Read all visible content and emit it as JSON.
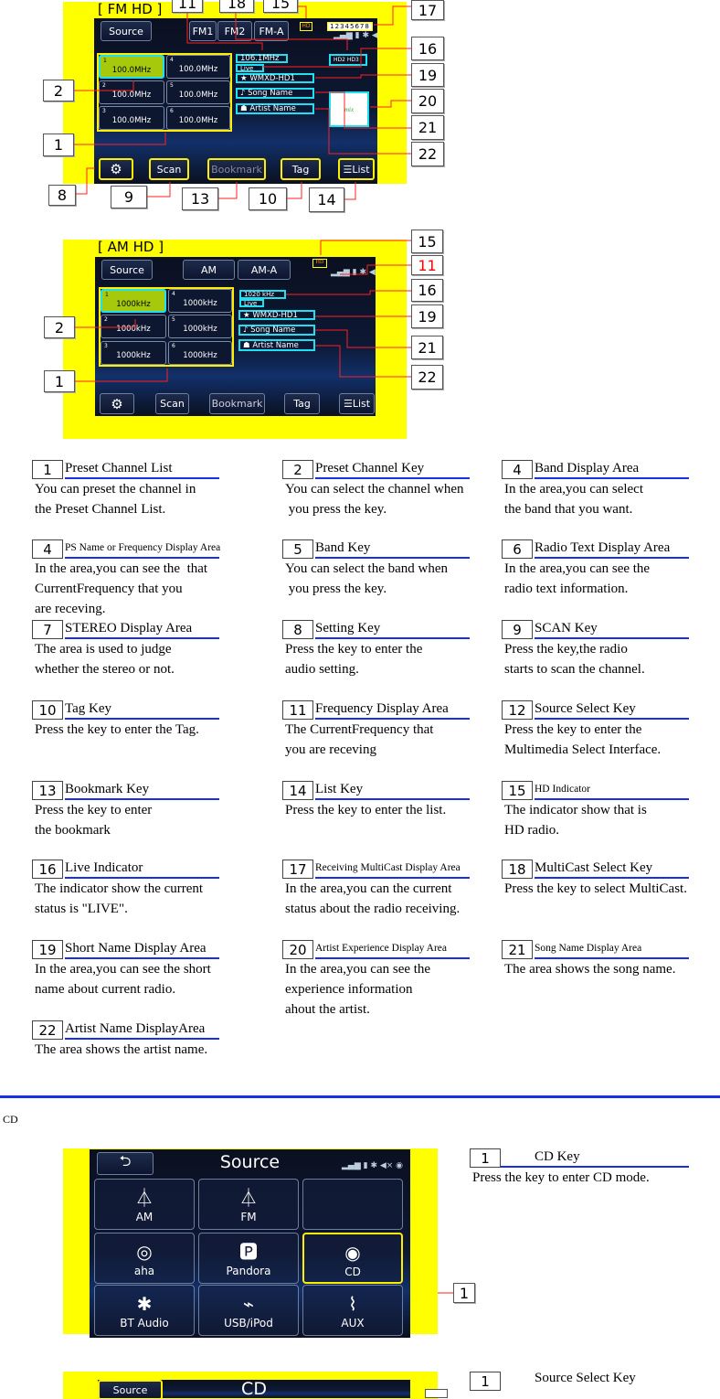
{
  "fm_screen": {
    "heading": "[ FM HD ]",
    "source": "Source",
    "bands": [
      "FM1",
      "FM2",
      "FM-A"
    ],
    "hd_icon": "HD",
    "multicast": "12345678",
    "status_icons": "signal battery bluetooth mute settings",
    "presets": [
      {
        "num": "1",
        "freq": "100.0MHz"
      },
      {
        "num": "2",
        "freq": "100.0MHz"
      },
      {
        "num": "3",
        "freq": "100.0MHz"
      },
      {
        "num": "4",
        "freq": "100.0MHz"
      },
      {
        "num": "5",
        "freq": "100.0MHz"
      },
      {
        "num": "6",
        "freq": "100.0MHz"
      }
    ],
    "frequency": "106.1MHz",
    "live": "Live",
    "multicast_select": "HD2 HD3",
    "short_name": "WMXD-HD1",
    "song_name": "Song Name",
    "artist_name": "Artist Name",
    "bottom": {
      "scan": "Scan",
      "bookmark": "Bookmark",
      "tag": "Tag",
      "list": "List"
    },
    "callouts": {
      "c11": "11",
      "c18": "18",
      "c15": "15",
      "c17": "17",
      "c16": "16",
      "c19": "19",
      "c20": "20",
      "c21": "21",
      "c22": "22",
      "c2": "2",
      "c1": "1",
      "c8": "8",
      "c9": "9",
      "c13": "13",
      "c10": "10",
      "c14": "14"
    }
  },
  "am_screen": {
    "heading": "[ AM HD ]",
    "source": "Source",
    "bands": [
      "AM",
      "AM-A"
    ],
    "presets": [
      {
        "num": "1",
        "freq": "1000kHz"
      },
      {
        "num": "2",
        "freq": "1000kHz"
      },
      {
        "num": "3",
        "freq": "1000kHz"
      },
      {
        "num": "4",
        "freq": "1000kHz"
      },
      {
        "num": "5",
        "freq": "1000kHz"
      },
      {
        "num": "6",
        "freq": "1000kHz"
      }
    ],
    "frequency": "1020 kHz",
    "live": "Live",
    "short_name": "WMXD-HD1",
    "song_name": "Song Name",
    "artist_name": "Artist Name",
    "bottom": {
      "scan": "Scan",
      "bookmark": "Bookmark",
      "tag": "Tag",
      "list": "List"
    },
    "callouts": {
      "c15": "15",
      "c11": "11",
      "c16": "16",
      "c19": "19",
      "c21": "21",
      "c22": "22",
      "c2": "2",
      "c1": "1"
    }
  },
  "descriptions": [
    {
      "num": "1",
      "title": "Preset Channel List",
      "body": "You can preset the channel in\nthe Preset Channel List."
    },
    {
      "num": "2",
      "title": "Preset Channel Key",
      "body": "You can select the channel when\n you press the key."
    },
    {
      "num": "4",
      "title": "Band Display Area",
      "body": "In the area,you can select\nthe band that you want."
    },
    {
      "num": "4",
      "title": "PS Name or Frequency Display Area",
      "small": true,
      "body": "In the area,you can see the  that\nCurrentFrequency that you\nare receving."
    },
    {
      "num": "5",
      "title": "Band Key",
      "body": "You can select the band when\n you press the key."
    },
    {
      "num": "6",
      "title": "Radio Text Display Area",
      "body": "In the area,you can see the\nradio text information."
    },
    {
      "num": "7",
      "title": "STEREO Display Area",
      "body": "The area is used to judge\nwhether the stereo or not."
    },
    {
      "num": "8",
      "title": "Setting Key",
      "body": "Press the key to enter the\naudio setting."
    },
    {
      "num": "9",
      "title": "SCAN Key",
      "body": "Press the key,the radio\nstarts to scan the channel."
    },
    {
      "num": "10",
      "title": "Tag Key",
      "body": "Press the key to enter the Tag."
    },
    {
      "num": "11",
      "title": "Frequency Display Area",
      "body": "The CurrentFrequency that\nyou are receving"
    },
    {
      "num": "12",
      "title": "Source Select Key",
      "body": "Press the key to enter the\nMultimedia Select Interface."
    },
    {
      "num": "13",
      "title": "Bookmark Key",
      "body": "Press the key to enter\nthe bookmark"
    },
    {
      "num": "14",
      "title": "List Key",
      "body": "Press the key to enter the list."
    },
    {
      "num": "15",
      "title": "HD Indicator",
      "small": true,
      "body": "The indicator show that is\nHD radio."
    },
    {
      "num": "16",
      "title": "Live Indicator",
      "body": "The indicator show the current\nstatus is \"LIVE\"."
    },
    {
      "num": "17",
      "title": "Receiving MultiCast Display Area",
      "small": true,
      "body": "In the area,you can the current\nstatus about the radio receiving."
    },
    {
      "num": "18",
      "title": "MultiCast Select Key",
      "body": "Press the key to select MultiCast."
    },
    {
      "num": "19",
      "title": "Short Name Display Area",
      "body": "In the area,you can see the short\nname about current radio."
    },
    {
      "num": "20",
      "title": "Artist Experience Display Area",
      "small": true,
      "body": "In the area,you can see the\nexperience information\nahout the artist."
    },
    {
      "num": "21",
      "title": "Song Name Display Area",
      "small": true,
      "body": "The area shows the song name."
    },
    {
      "num": "22",
      "title": "Artist Name DisplayArea",
      "body": "The area shows the artist name."
    }
  ],
  "cd_section": {
    "heading": "CD",
    "source_screen": {
      "title": "Source",
      "items": [
        {
          "label": "AM",
          "icon": "antenna-icon"
        },
        {
          "label": "FM",
          "icon": "antenna-icon"
        },
        {
          "label": "",
          "icon": ""
        },
        {
          "label": "aha",
          "icon": "aha-icon"
        },
        {
          "label": "Pandora",
          "icon": "pandora-icon"
        },
        {
          "label": "CD",
          "icon": "disc-icon"
        },
        {
          "label": "BT  Audio",
          "icon": "bluetooth-icon"
        },
        {
          "label": "USB/iPod",
          "icon": "usb-icon"
        },
        {
          "label": "AUX",
          "icon": "aux-icon"
        }
      ],
      "callout": "1"
    },
    "cd_key": {
      "num": "1",
      "title": "CD Key",
      "body": "Press the key to enter CD mode."
    },
    "cd_screen": {
      "source": "Source",
      "title": "CD"
    },
    "source_select": {
      "num": "1",
      "title": "Source Select Key"
    }
  },
  "colors": {
    "highlight": "#ffff00",
    "cyan_frame": "#1ee0f0",
    "arrow": "#ff0000",
    "rule": "#1a2ee6",
    "preset_selected": "#a7c90c"
  }
}
